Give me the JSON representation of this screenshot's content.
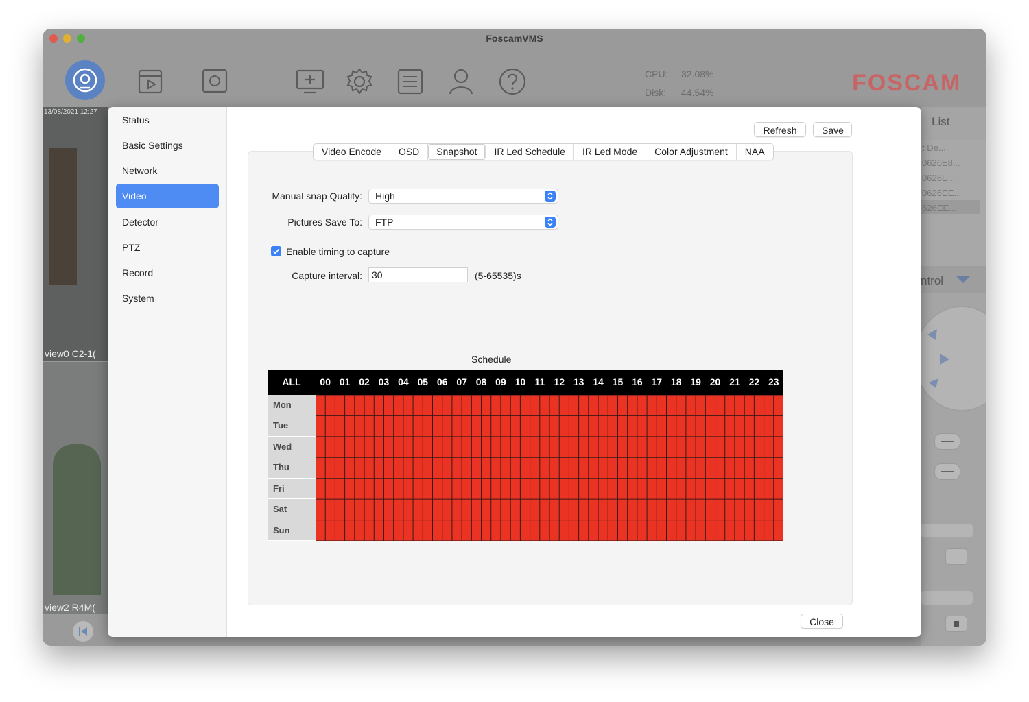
{
  "app": {
    "title": "FoscamVMS",
    "stats": {
      "cpu_label": "CPU:",
      "cpu_value": "32.08%",
      "disk_label": "Disk:",
      "disk_value": "44.54%"
    },
    "logo": "FOSCAM",
    "feeds": [
      {
        "timestamp": "13/08/2021 12:27",
        "label": "view0  C2-1("
      },
      {
        "label": "view2  R4M("
      }
    ],
    "right_panel": {
      "list_title": "List",
      "items": [
        "t De...",
        "0626E8...",
        "0626E...",
        "0626EE...",
        "626EE..."
      ],
      "control_label": "ntrol"
    }
  },
  "dialog": {
    "sidebar": [
      {
        "label": "Status"
      },
      {
        "label": "Basic Settings"
      },
      {
        "label": "Network"
      },
      {
        "label": "Video",
        "active": true
      },
      {
        "label": "Detector"
      },
      {
        "label": "PTZ"
      },
      {
        "label": "Record"
      },
      {
        "label": "System"
      }
    ],
    "buttons": {
      "refresh": "Refresh",
      "save": "Save",
      "close": "Close"
    },
    "tabs": [
      {
        "label": "Video Encode"
      },
      {
        "label": "OSD"
      },
      {
        "label": "Snapshot",
        "selected": true
      },
      {
        "label": "IR Led Schedule"
      },
      {
        "label": "IR Led Mode"
      },
      {
        "label": "Color Adjustment"
      },
      {
        "label": "NAA"
      }
    ],
    "form": {
      "quality_label": "Manual snap Quality:",
      "quality_value": "High",
      "save_to_label": "Pictures Save To:",
      "save_to_value": "FTP",
      "timing_label": "Enable timing to capture",
      "timing_checked": true,
      "interval_label": "Capture interval:",
      "interval_value": "30",
      "interval_hint": "(5-65535)s"
    },
    "schedule": {
      "title": "Schedule",
      "all_label": "ALL",
      "hours": [
        "00",
        "01",
        "02",
        "03",
        "04",
        "05",
        "06",
        "07",
        "08",
        "09",
        "10",
        "11",
        "12",
        "13",
        "14",
        "15",
        "16",
        "17",
        "18",
        "19",
        "20",
        "21",
        "22",
        "23"
      ],
      "days": [
        "Mon",
        "Tue",
        "Wed",
        "Thu",
        "Fri",
        "Sat",
        "Sun"
      ],
      "active_color": "#ea3323"
    }
  }
}
